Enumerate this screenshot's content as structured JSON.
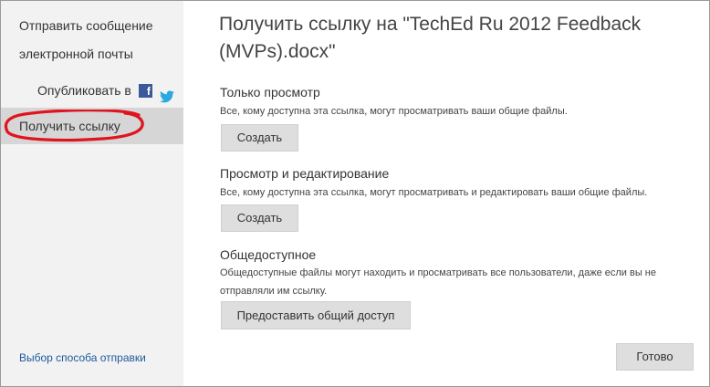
{
  "dialog": {
    "title": "Получить ссылку на \"TechEd Ru 2012 Feedback (MVPs).docx\""
  },
  "sidebar": {
    "items": [
      {
        "label": "Отправить сообщение электронной почты"
      },
      {
        "label": "Опубликовать в"
      },
      {
        "label": "Получить ссылку"
      }
    ],
    "social": {
      "facebook_icon": "facebook-icon",
      "twitter_icon": "twitter-icon"
    },
    "footer_link": "Выбор способа отправки"
  },
  "sections": [
    {
      "title": "Только просмотр",
      "description": "Все, кому доступна эта ссылка, могут просматривать ваши общие файлы.",
      "button": "Создать"
    },
    {
      "title": "Просмотр и редактирование",
      "description": "Все, кому доступна эта ссылка, могут просматривать и редактировать ваши общие файлы.",
      "button": "Создать"
    },
    {
      "title": "Общедоступное",
      "description": "Общедоступные файлы могут находить и просматривать все пользователи, даже если вы не отправляли им ссылку.",
      "button": "Предоставить общий доступ"
    }
  ],
  "footer": {
    "done_label": "Готово"
  },
  "colors": {
    "sidebar_bg": "#f2f2f2",
    "selected_bg": "#d6d6d6",
    "button_bg": "#dedede",
    "link": "#1e5a9c",
    "annotation_red": "#e0141e",
    "facebook_blue": "#3b5998",
    "twitter_blue": "#2aa9e0"
  }
}
